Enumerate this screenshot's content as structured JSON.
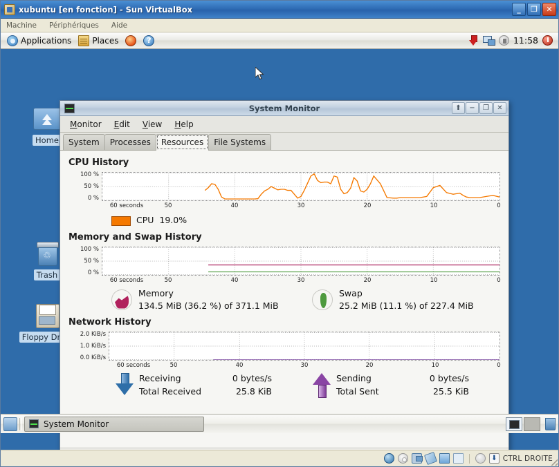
{
  "vbox": {
    "title": "xubuntu [en fonction] - Sun VirtualBox",
    "icon": "virtualbox-icon",
    "window_buttons": {
      "minimize": "_",
      "maximize": "❐",
      "close": "✕"
    },
    "menus": [
      "Machine",
      "Périphériques",
      "Aide"
    ],
    "statusbar": {
      "icons": [
        "hdd-icon",
        "cd-icon",
        "network-icon",
        "usb-icon",
        "shared-folder-icon",
        "display-icon",
        "clock-icon",
        "host-key-icon"
      ],
      "host_key": "CTRL DROITE"
    }
  },
  "xfce_panel": {
    "applications_label": "Applications",
    "places_label": "Places",
    "firefox_icon": "firefox-icon",
    "help_icon": "help-icon",
    "help_glyph": "?",
    "tray": {
      "updates_icon": "update-manager-icon",
      "network_icon": "network-manager-icon",
      "volume_icon": "volume-icon",
      "clock": "11:58",
      "logout_icon": "logout-icon"
    }
  },
  "desktop_icons": [
    {
      "label": "Home",
      "icon": "home-folder-icon"
    },
    {
      "label": "Trash",
      "icon": "trash-icon"
    },
    {
      "label": "Floppy Drive",
      "icon": "floppy-drive-icon"
    }
  ],
  "system_monitor": {
    "title": "System Monitor",
    "app_icon": "system-monitor-icon",
    "window_buttons": {
      "shade": "⬆",
      "minimize": "−",
      "maximize": "❐",
      "close": "✕"
    },
    "menus": [
      {
        "label": "Monitor",
        "mnemonic": "M"
      },
      {
        "label": "Edit",
        "mnemonic": "E"
      },
      {
        "label": "View",
        "mnemonic": "V"
      },
      {
        "label": "Help",
        "mnemonic": "H"
      }
    ],
    "tabs": [
      {
        "label": "System",
        "active": false
      },
      {
        "label": "Processes",
        "active": false
      },
      {
        "label": "Resources",
        "active": true
      },
      {
        "label": "File Systems",
        "active": false
      }
    ],
    "sections": {
      "cpu": {
        "title": "CPU History",
        "legend": {
          "name": "CPU",
          "value": "19.0%",
          "color": "#f57900"
        }
      },
      "memory": {
        "title": "Memory and Swap History",
        "memory": {
          "name": "Memory",
          "value": "134.5 MiB (36.2 %) of 371.1 MiB",
          "color": "#ad215e",
          "icon": "memory-pie-icon"
        },
        "swap": {
          "name": "Swap",
          "value": "25.2 MiB (11.1 %) of 227.4 MiB",
          "color": "#4e9a3e",
          "icon": "swap-pie-icon"
        }
      },
      "network": {
        "title": "Network History",
        "receiving": {
          "icon": "arrow-down-icon",
          "rate_label": "Receiving",
          "rate_value": "0 bytes/s",
          "total_label": "Total Received",
          "total_value": "25.8 KiB",
          "color": "#2e6ea8"
        },
        "sending": {
          "icon": "arrow-up-icon",
          "rate_label": "Sending",
          "rate_value": "0 bytes/s",
          "total_label": "Total Sent",
          "total_value": "25.5 KiB",
          "color": "#8a45a4"
        }
      }
    }
  },
  "taskbar": {
    "show_desktop_icon": "show-desktop-icon",
    "tasks": [
      {
        "label": "System Monitor",
        "icon": "system-monitor-icon"
      }
    ],
    "workspaces": [
      "1",
      "2"
    ],
    "trash_icon": "trash-icon"
  },
  "chart_data": [
    {
      "type": "line",
      "id": "cpu-history",
      "title": "CPU History",
      "xlabel": "",
      "ylabel": "",
      "xlim": [
        60,
        0
      ],
      "ylim": [
        0,
        100
      ],
      "x_ticks": [
        "60 seconds",
        "50",
        "40",
        "30",
        "20",
        "10",
        "0"
      ],
      "x_tick_values": [
        60,
        50,
        40,
        30,
        20,
        10,
        0
      ],
      "y_ticks": [
        "100 %",
        "50 %",
        "0 %"
      ],
      "y_tick_values": [
        100,
        50,
        0
      ],
      "grid": true,
      "legend": [
        {
          "name": "CPU",
          "value": 19.0,
          "unit": "%",
          "color": "#f57900"
        }
      ],
      "series": [
        {
          "name": "CPU",
          "color": "#f57900",
          "x": [
            44.5,
            44.0,
            43.5,
            43.0,
            42.5,
            42.0,
            41.5,
            41.0,
            40.5,
            40.0,
            39.5,
            39.0,
            38.5,
            38.0,
            37.5,
            37.0,
            36.5,
            36.0,
            35.5,
            35.0,
            34.5,
            34.0,
            33.5,
            33.0,
            32.5,
            32.0,
            31.5,
            31.0,
            30.5,
            30.0,
            29.5,
            29.0,
            28.5,
            28.0,
            27.5,
            27.0,
            26.5,
            26.0,
            25.5,
            25.0,
            24.5,
            24.0,
            23.5,
            23.0,
            22.5,
            22.0,
            21.5,
            21.0,
            20.5,
            20.0,
            19.5,
            19.0,
            18.0,
            17.0,
            16.0,
            15.5,
            15.0,
            14.5,
            14.0,
            13.5,
            13.0,
            12.0,
            11.0,
            10.0,
            9.0,
            8.0,
            7.0,
            6.0,
            5.5,
            5.0,
            4.5,
            4.0,
            3.0,
            2.0,
            1.0,
            0.0
          ],
          "y": [
            36,
            46,
            60,
            58,
            40,
            12,
            5,
            5,
            5,
            5,
            5,
            5,
            5,
            5,
            5,
            5,
            6,
            22,
            34,
            40,
            50,
            44,
            38,
            40,
            40,
            36,
            36,
            22,
            8,
            14,
            36,
            62,
            88,
            96,
            72,
            64,
            66,
            66,
            60,
            88,
            84,
            40,
            24,
            28,
            44,
            82,
            70,
            34,
            30,
            40,
            60,
            88,
            60,
            10,
            8,
            8,
            10,
            10,
            10,
            10,
            10,
            10,
            14,
            46,
            54,
            28,
            22,
            26,
            18,
            12,
            10,
            10,
            10,
            14,
            18,
            12
          ]
        }
      ]
    },
    {
      "type": "line",
      "id": "memory-swap-history",
      "title": "Memory and Swap History",
      "xlim": [
        60,
        0
      ],
      "ylim": [
        0,
        100
      ],
      "x_ticks": [
        "60 seconds",
        "50",
        "40",
        "30",
        "20",
        "10",
        "0"
      ],
      "x_tick_values": [
        60,
        50,
        40,
        30,
        20,
        10,
        0
      ],
      "y_ticks": [
        "100 %",
        "50 %",
        "0 %"
      ],
      "y_tick_values": [
        100,
        50,
        0
      ],
      "grid": true,
      "series": [
        {
          "name": "Memory",
          "color": "#ad215e",
          "x": [
            44,
            0
          ],
          "y": [
            36.2,
            36.2
          ]
        },
        {
          "name": "Swap",
          "color": "#4e9a3e",
          "x": [
            44,
            0
          ],
          "y": [
            11.1,
            11.1
          ]
        }
      ],
      "legend": [
        {
          "name": "Memory",
          "value": "134.5 MiB (36.2 %) of 371.1 MiB",
          "color": "#ad215e"
        },
        {
          "name": "Swap",
          "value": "25.2 MiB (11.1 %) of 227.4 MiB",
          "color": "#4e9a3e"
        }
      ]
    },
    {
      "type": "line",
      "id": "network-history",
      "title": "Network History",
      "xlim": [
        60,
        0
      ],
      "ylim": [
        0,
        2.0
      ],
      "x_ticks": [
        "60 seconds",
        "50",
        "40",
        "30",
        "20",
        "10",
        "0"
      ],
      "x_tick_values": [
        60,
        50,
        40,
        30,
        20,
        10,
        0
      ],
      "y_ticks": [
        "2.0 KiB/s",
        "1.0 KiB/s",
        "0.0 KiB/s"
      ],
      "y_tick_values": [
        2.0,
        1.0,
        0.0
      ],
      "grid": true,
      "series": [
        {
          "name": "Receiving",
          "color": "#2e6ea8",
          "x": [
            44,
            0
          ],
          "y": [
            0,
            0
          ]
        },
        {
          "name": "Sending",
          "color": "#8a45a4",
          "x": [
            44,
            0
          ],
          "y": [
            0,
            0
          ]
        }
      ],
      "legend": [
        {
          "name": "Receiving",
          "value": "0 bytes/s",
          "total_label": "Total Received",
          "total": "25.8 KiB",
          "color": "#2e6ea8"
        },
        {
          "name": "Sending",
          "value": "0 bytes/s",
          "total_label": "Total Sent",
          "total": "25.5 KiB",
          "color": "#8a45a4"
        }
      ]
    }
  ]
}
